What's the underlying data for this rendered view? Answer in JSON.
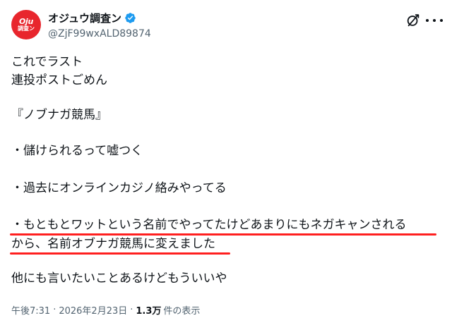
{
  "author": {
    "avatar_text_line1": "Oju",
    "avatar_text_line2": "調査ン",
    "display_name": "オジュウ調査ン",
    "handle": "@ZjF99wxALD89874",
    "verified": true
  },
  "tweet": {
    "lines": [
      "これでラスト",
      "連投ポストごめん",
      "",
      "『ノブナガ競馬』",
      "",
      "・儲けられるって嘘つく",
      "",
      "・過去にオンラインカジノ絡みやってる",
      "",
      "・もともとワットという名前でやってたけどあまりにもネガキャンされる",
      "から、名前オブナガ競馬に変えました",
      "",
      "他にも言いたいことあるけどもういいや"
    ]
  },
  "meta": {
    "time": "午後7:31",
    "date": "2026年2月23日",
    "views_count": "1.3万",
    "views_label": "件の表示",
    "separator": "·"
  },
  "colors": {
    "avatar_bg": "#e8262d",
    "verified_blue": "#1d9bf0",
    "underline_red": "#ff1f1f",
    "secondary_text": "#536471"
  },
  "icons": {
    "verified": "verified-badge-icon",
    "grok": "grok-icon",
    "more": "more-options-icon"
  }
}
